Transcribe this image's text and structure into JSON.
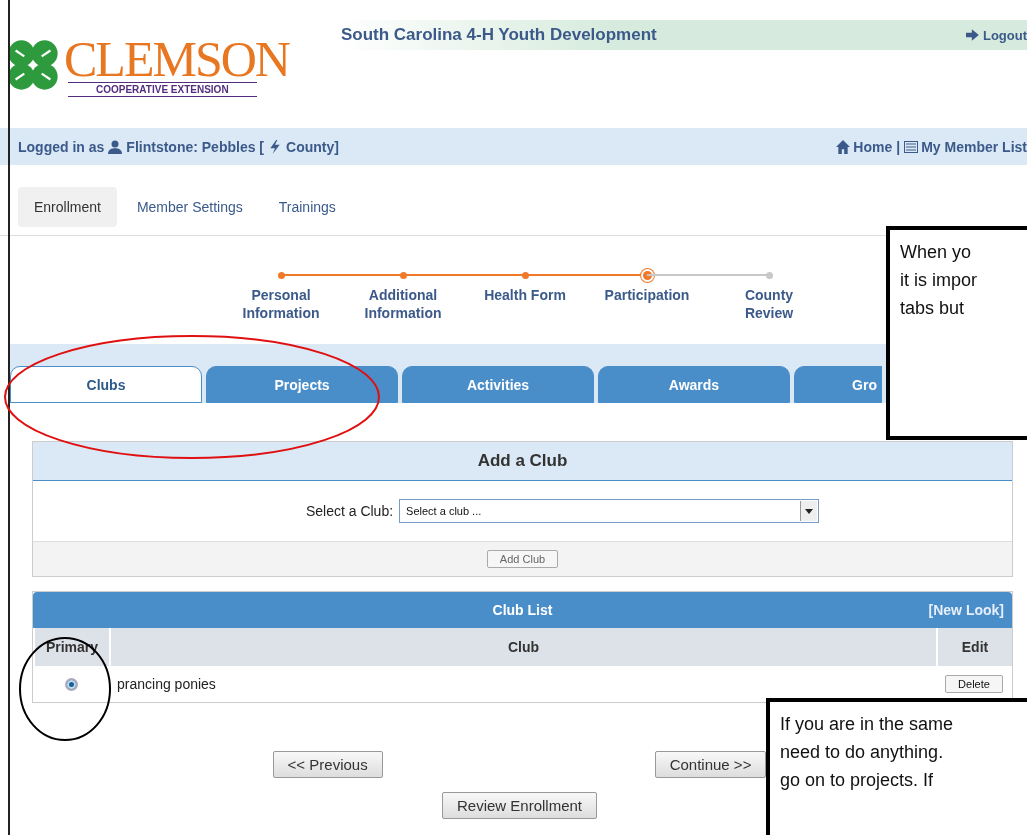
{
  "header": {
    "logo_main": "CLEMSON",
    "logo_sub": "COOPERATIVE EXTENSION",
    "title": "South Carolina 4-H Youth Development",
    "logout": "Logout"
  },
  "login_bar": {
    "prefix": "Logged in as",
    "user": "Flintstone: Pebbles [",
    "county": "County]",
    "home": "Home",
    "separator": "|",
    "member_list": "My Member List"
  },
  "nav_tabs": [
    {
      "label": "Enrollment",
      "selected": true
    },
    {
      "label": "Member Settings",
      "selected": false
    },
    {
      "label": "Trainings",
      "selected": false
    }
  ],
  "steps": [
    {
      "label": "Personal Information",
      "completed": true,
      "current": false
    },
    {
      "label": "Additional Information",
      "completed": true,
      "current": false
    },
    {
      "label": "Health Form",
      "completed": true,
      "current": false
    },
    {
      "label": "Participation",
      "completed": true,
      "current": true
    },
    {
      "label": "County Review",
      "completed": false,
      "current": false
    }
  ],
  "tabs": [
    {
      "label": "Clubs",
      "selected": true
    },
    {
      "label": "Projects",
      "selected": false
    },
    {
      "label": "Activities",
      "selected": false
    },
    {
      "label": "Awards",
      "selected": false
    },
    {
      "label": "Gro",
      "selected": false
    }
  ],
  "add_club": {
    "title": "Add a Club",
    "field_label": "Select a Club:",
    "select_value": "Select a club ...",
    "button": "Add Club"
  },
  "club_list": {
    "title": "Club List",
    "new_look": "[New Look]",
    "columns": [
      "Primary",
      "Club",
      "Edit"
    ],
    "rows": [
      {
        "primary": true,
        "club": "prancing ponies",
        "action": "Delete"
      }
    ]
  },
  "buttons": {
    "previous": "<< Previous",
    "continue": "Continue >>",
    "review": "Review Enrollment"
  },
  "callouts": [
    {
      "lines": [
        "When yo",
        "it is impor",
        "tabs but"
      ]
    },
    {
      "lines": [
        "If you are in the same",
        "need to do anything.",
        "go on to projects. If"
      ]
    }
  ]
}
